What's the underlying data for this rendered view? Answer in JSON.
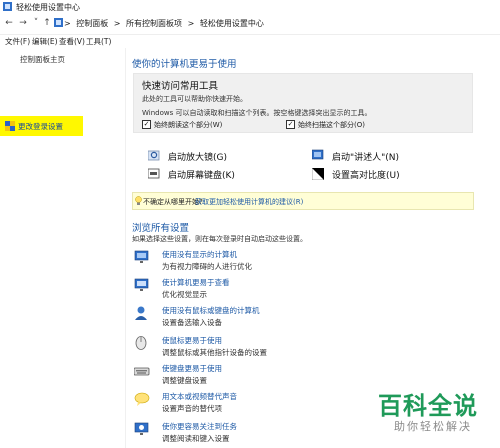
{
  "window": {
    "title": "轻松使用设置中心"
  },
  "address": {
    "crumbs": [
      "控制面板",
      "所有控制面板项",
      "轻松使用设置中心"
    ],
    "sep": ">"
  },
  "menu": [
    "文件(F)",
    "编辑(E)",
    "查看(V)",
    "工具(T)"
  ],
  "sidebar": {
    "home": "控制面板主页",
    "selected": "更改登录设置"
  },
  "main": {
    "heading": "使你的计算机更易于使用",
    "quick": {
      "title": "快速访问常用工具",
      "line1": "此处的工具可以帮助你快速开始。",
      "line2": "Windows 可以自动读取和扫描这个列表。按空格键选择突出显示的工具。",
      "check_read": "始终朗读这个部分(W)",
      "check_scan": "始终扫描这个部分(O)"
    },
    "tools": {
      "magnifier": "启动放大镜(G)",
      "narrator": "启动\"讲述人\"(N)",
      "osk": "启动屏幕键盘(K)",
      "contrast": "设置高对比度(U)"
    },
    "hint": {
      "question": "不确定从哪里开始?",
      "link": "获取更加轻松使用计算机的建议(R)"
    },
    "browse": {
      "heading": "浏览所有设置",
      "subtitle": "如果选择这些设置，则在每次登录时自动启动这些设置。",
      "items": [
        {
          "title": "使用没有显示的计算机",
          "desc": "为有视力障碍的人进行优化"
        },
        {
          "title": "使计算机更易于查看",
          "desc": "优化视觉显示"
        },
        {
          "title": "使用没有鼠标或键盘的计算机",
          "desc": "设置备选输入设备"
        },
        {
          "title": "使鼠标更易于使用",
          "desc": "调整鼠标或其他指针设备的设置"
        },
        {
          "title": "使键盘更易于使用",
          "desc": "调整键盘设置"
        },
        {
          "title": "用文本或视频替代声音",
          "desc": "设置声音的替代项"
        },
        {
          "title": "使你更容易关注到任务",
          "desc": "调整阅读和键入设置"
        }
      ]
    }
  },
  "watermark": {
    "big": "百科全说",
    "small": "助你轻松解决"
  },
  "colors": {
    "link": "#1e5aa6",
    "highlight": "#fff800",
    "watermark": "#1f9a59"
  }
}
